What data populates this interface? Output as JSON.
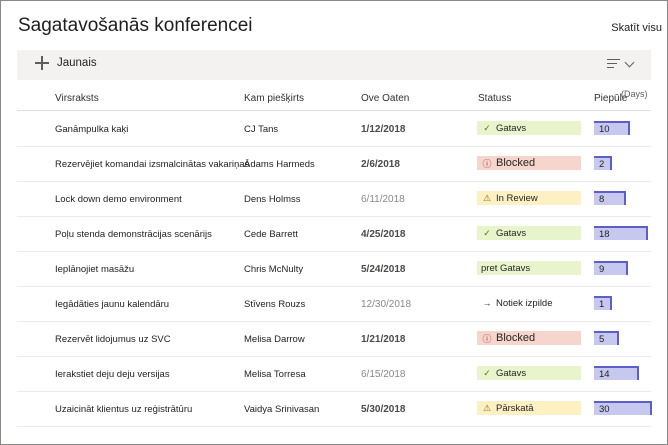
{
  "title": "Sagatavošanās konferencei",
  "see_all": "Skatīt visu",
  "toolbar": {
    "new_label": "Jaunais"
  },
  "columns": {
    "title": "Virsraksts",
    "assigned": "Kam piešķirts",
    "due": "Ove Oaten",
    "status": "Statuss",
    "effort": "Piepūle",
    "effort_unit": "(Days)"
  },
  "rows": [
    {
      "title": "Ganāmpulka kaķi",
      "assigned": "CJ Tans",
      "due": "1/12/2018",
      "status": "Gatavs",
      "effort": 10
    },
    {
      "title": "Rezervējiet komandai izsmalcinātas vakariņas",
      "assigned": "Ādams Harmeds",
      "due": "2/6/2018",
      "status": "Blocked",
      "effort": 2
    },
    {
      "title": "Lock down demo environment",
      "assigned": "Dens Holmss",
      "due": "6/11/2018",
      "status": "In Review",
      "effort": 8
    },
    {
      "title": "Poļu stenda demonstrācijas scenārijs",
      "assigned": "Cede Barrett",
      "due": "4/25/2018",
      "status": "Gatavs",
      "effort": 18
    },
    {
      "title": "Ieplānojiet masāžu",
      "assigned": "Chris McNulty",
      "due": "5/24/2018",
      "status": "pret Gatavs",
      "effort": 9
    },
    {
      "title": "Iegādāties jaunu kalendāru",
      "assigned": "Stīvens Rouzs",
      "due": "12/30/2018",
      "status": "Notiek izpilde",
      "effort": 1
    },
    {
      "title": "Rezervēt lidojumus uz SVC",
      "assigned": "Melisa Darrow",
      "due": "1/21/2018",
      "status": "Blocked",
      "effort": 5
    },
    {
      "title": "Ierakstiet deju deju versijas",
      "assigned": "Melisa Torresa",
      "due": "6/15/2018",
      "status": "Gatavs",
      "effort": 14
    },
    {
      "title": "Uzaicināt klientus uz reģistrātūru",
      "assigned": "Vaidya Srinivasan",
      "due": "5/30/2018",
      "status": "Pārskatā",
      "effort": 30
    }
  ],
  "colors": {
    "status_done": "#e8f5cc",
    "status_blocked": "#f6d5cc",
    "status_review": "#fdf0c3",
    "effort_bar": "#c6c8ef",
    "effort_bar_edge": "#5b5fc7"
  }
}
